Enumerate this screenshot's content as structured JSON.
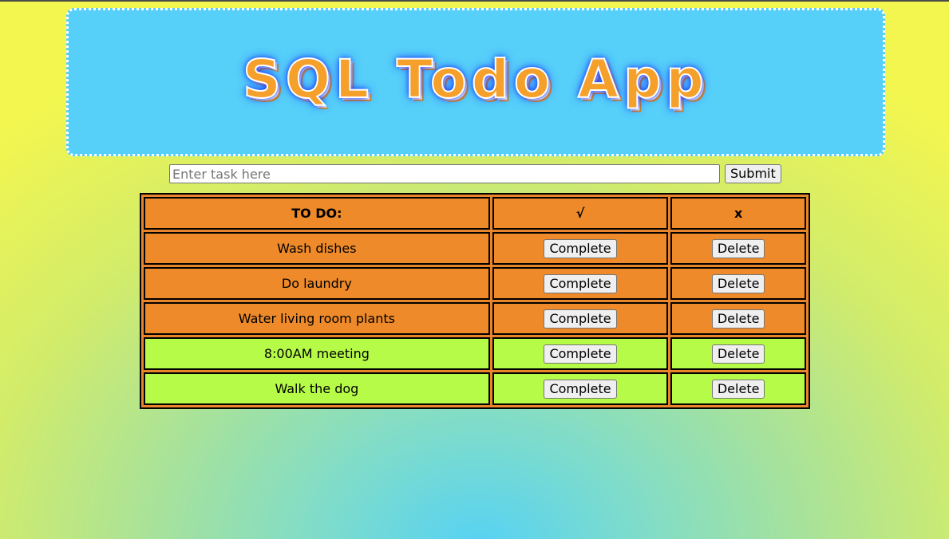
{
  "app": {
    "title": "SQL Todo App"
  },
  "form": {
    "input_placeholder": "Enter task here",
    "input_value": "",
    "submit_label": "Submit"
  },
  "table": {
    "headers": {
      "task": "TO DO:",
      "complete": "√",
      "delete": "x"
    },
    "rows": [
      {
        "task": "Wash dishes",
        "complete_label": "Complete",
        "delete_label": "Delete",
        "status": "pending",
        "color": "#ee8a2a"
      },
      {
        "task": "Do laundry",
        "complete_label": "Complete",
        "delete_label": "Delete",
        "status": "pending",
        "color": "#ee8a2a"
      },
      {
        "task": "Water living room plants",
        "complete_label": "Complete",
        "delete_label": "Delete",
        "status": "pending",
        "color": "#ee8a2a"
      },
      {
        "task": "8:00AM meeting",
        "complete_label": "Complete",
        "delete_label": "Delete",
        "status": "completed",
        "color": "#b6fb47"
      },
      {
        "task": "Walk the dog",
        "complete_label": "Complete",
        "delete_label": "Delete",
        "status": "completed",
        "color": "#b6fb47"
      }
    ]
  },
  "colors": {
    "banner": "#56cff9",
    "title_text": "#f5a02a",
    "pending_row": "#ee8a2a",
    "completed_row": "#b6fb47"
  }
}
